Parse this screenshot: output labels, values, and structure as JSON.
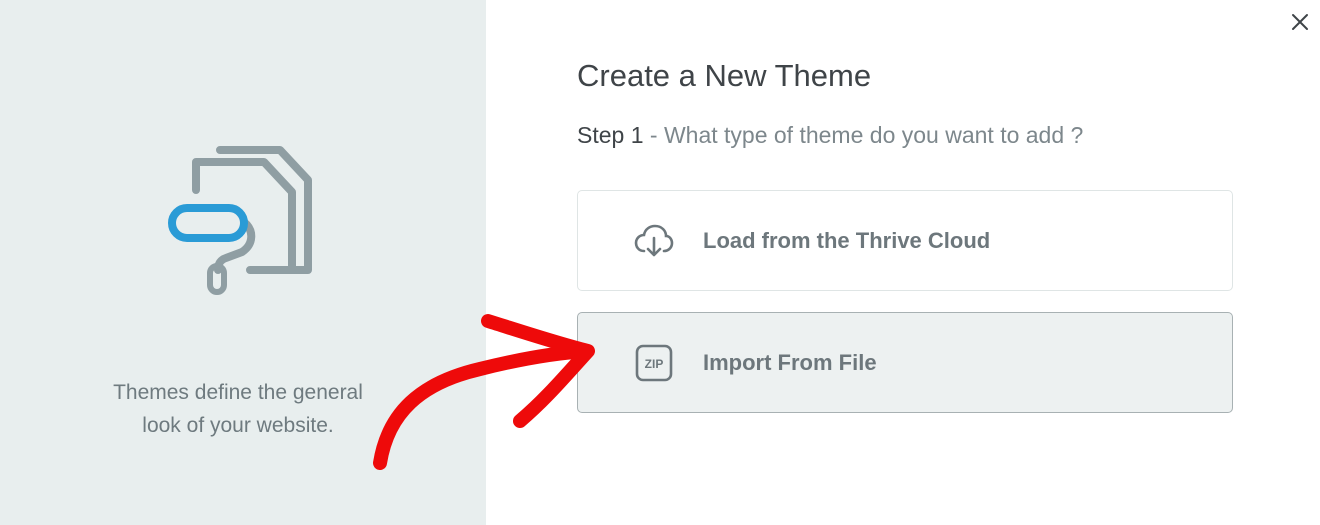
{
  "dialog": {
    "title": "Create a New Theme",
    "step_number": "Step 1",
    "step_separator": " - ",
    "step_question": "What type of theme do you want to add ?",
    "close_icon": "close-icon"
  },
  "left_panel": {
    "illustration_icon": "paint-roller-pages-icon",
    "caption_line1": "Themes define the general",
    "caption_line2": "look of your website."
  },
  "options": [
    {
      "label": "Load from the Thrive Cloud",
      "icon": "cloud-download-icon",
      "selected": false
    },
    {
      "label": "Import From File",
      "icon": "zip-file-icon",
      "selected": true
    }
  ],
  "annotation": {
    "icon": "red-arrow-pointer",
    "color": "#ee0a0a"
  },
  "colors": {
    "left_panel_bg": "#e8eeee",
    "icon_gray": "#8f9ea3",
    "icon_blue": "#2a9bd6",
    "text_dark": "#3f4448",
    "text_muted": "#7d878c",
    "selected_bg": "#edf1f1"
  }
}
